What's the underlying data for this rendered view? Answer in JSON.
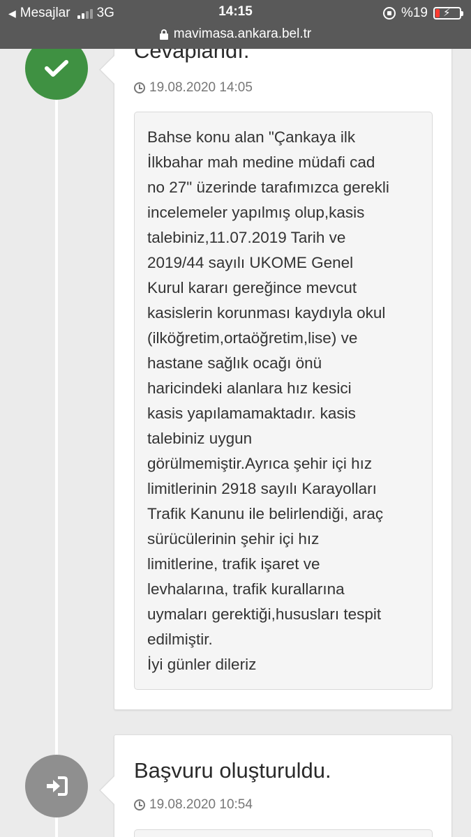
{
  "status_bar": {
    "back_label": "Mesajlar",
    "network": "3G",
    "time": "14:15",
    "battery_percent": "%19",
    "battery_level": 0.19
  },
  "url_bar": {
    "url": "mavimasa.ankara.bel.tr"
  },
  "timeline": [
    {
      "title": "Cevaplandı.",
      "date": "19.08.2020 14:05",
      "icon": "check-icon",
      "badge_color": "#3f9142",
      "body": "Bahse konu alan \"Çankaya ilk\nİlkbahar mah medine müdafi cad\nno 27\" üzerinde tarafımızca gerekli\nincelemeler yapılmış olup,kasis\ntalebiniz,11.07.2019 Tarih ve\n2019/44 sayılı UKOME Genel\nKurul kararı gereğince mevcut\nkasislerin korunması kaydıyla okul\n(ilköğretim,ortaöğretim,lise) ve\nhastane sağlık ocağı  önü\nharicindeki alanlara hız kesici\nkasis yapılamamaktadır. kasis\ntalebiniz uygun\ngörülmemiştir.Ayrıca şehir içi hız\nlimitlerinin 2918 sayılı Karayolları\nTrafik Kanunu ile belirlendiği, araç\nsürücülerinin şehir içi hız\nlimitlerine, trafik işaret ve\nlevhalarına, trafik kurallarına\nuymaları gerektiği,hususları tespit\nedilmiştir.\nİyi günler dileriz"
    },
    {
      "title": "Başvuru oluşturuldu.",
      "date": "19.08.2020 10:54",
      "icon": "sign-in-icon",
      "badge_color": "#8f8f8f",
      "body": ""
    }
  ]
}
